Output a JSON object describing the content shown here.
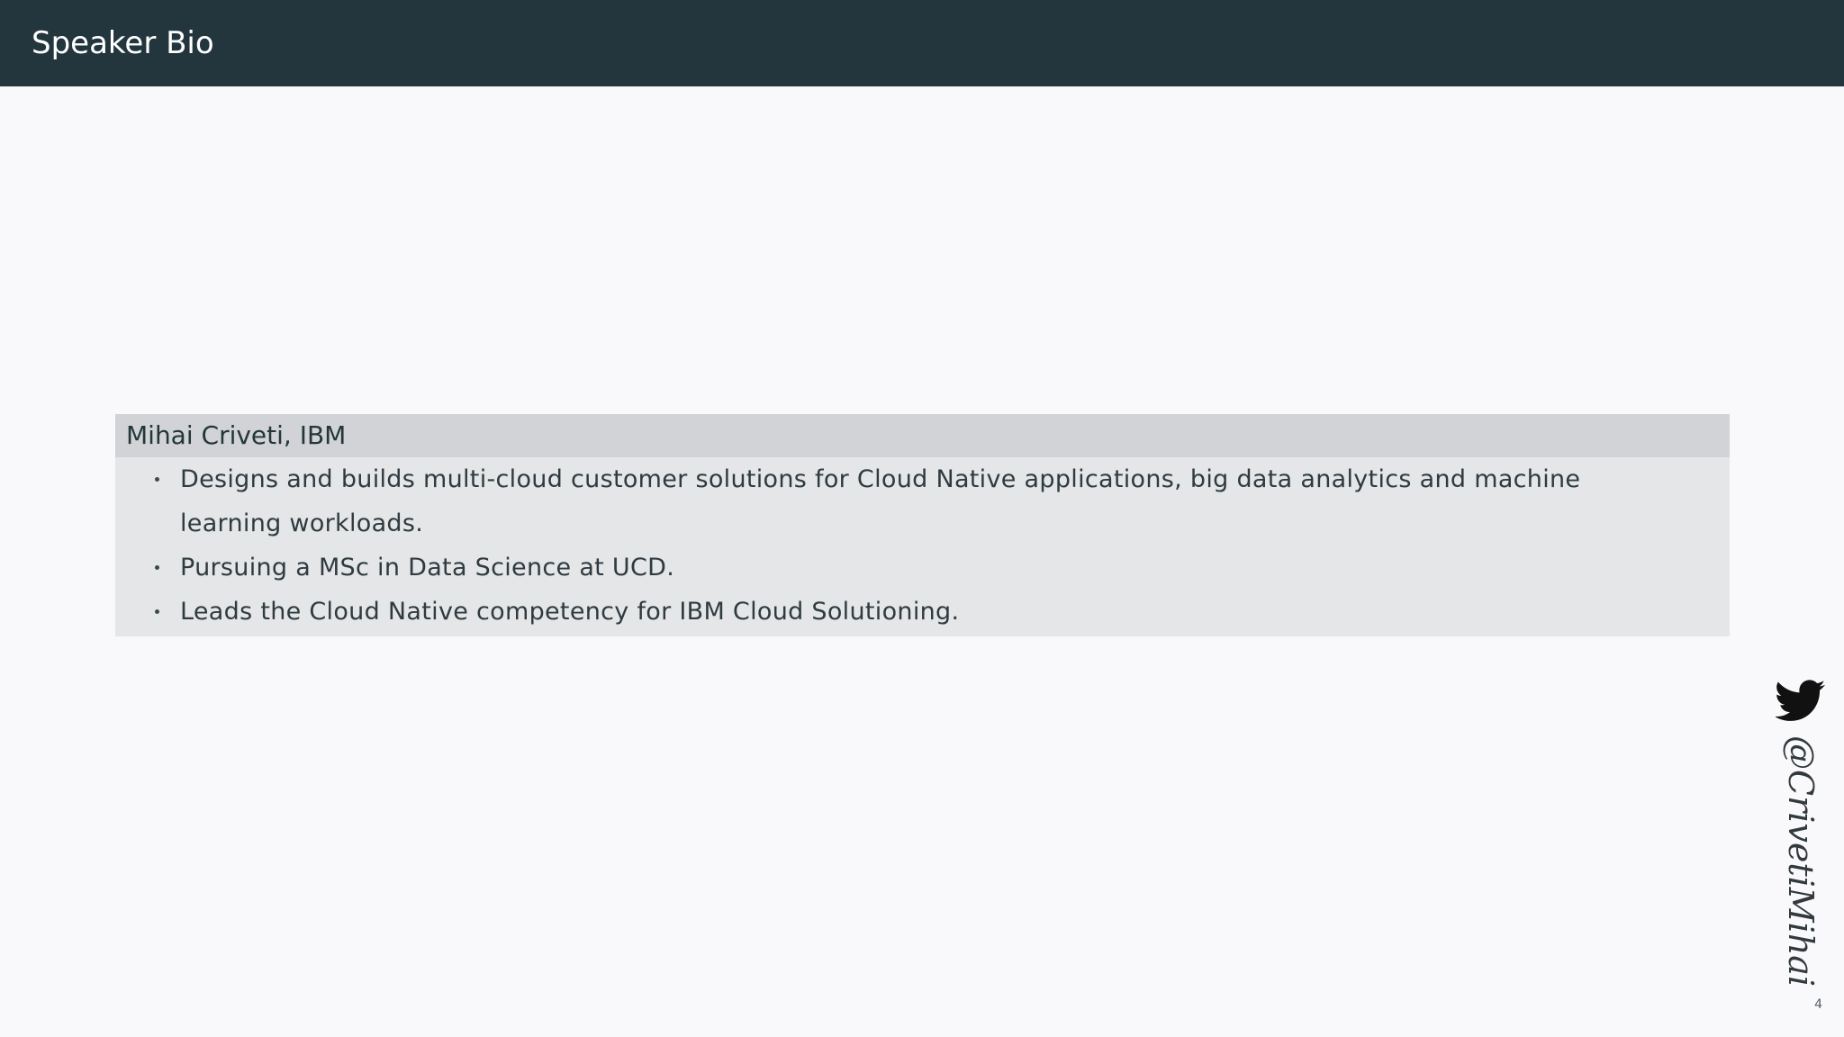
{
  "header": {
    "title": "Speaker Bio"
  },
  "block": {
    "title": "Mihai Criveti, IBM",
    "items": [
      "Designs and builds multi-cloud customer solutions for Cloud Native applications, big data analytics and machine learning workloads.",
      "Pursuing a MSc in Data Science at UCD.",
      "Leads the Cloud Native competency for IBM Cloud Solutioning."
    ]
  },
  "social": {
    "icon": "twitter-icon",
    "handle": "@CrivetiMihai"
  },
  "footer": {
    "page_number": "4"
  }
}
